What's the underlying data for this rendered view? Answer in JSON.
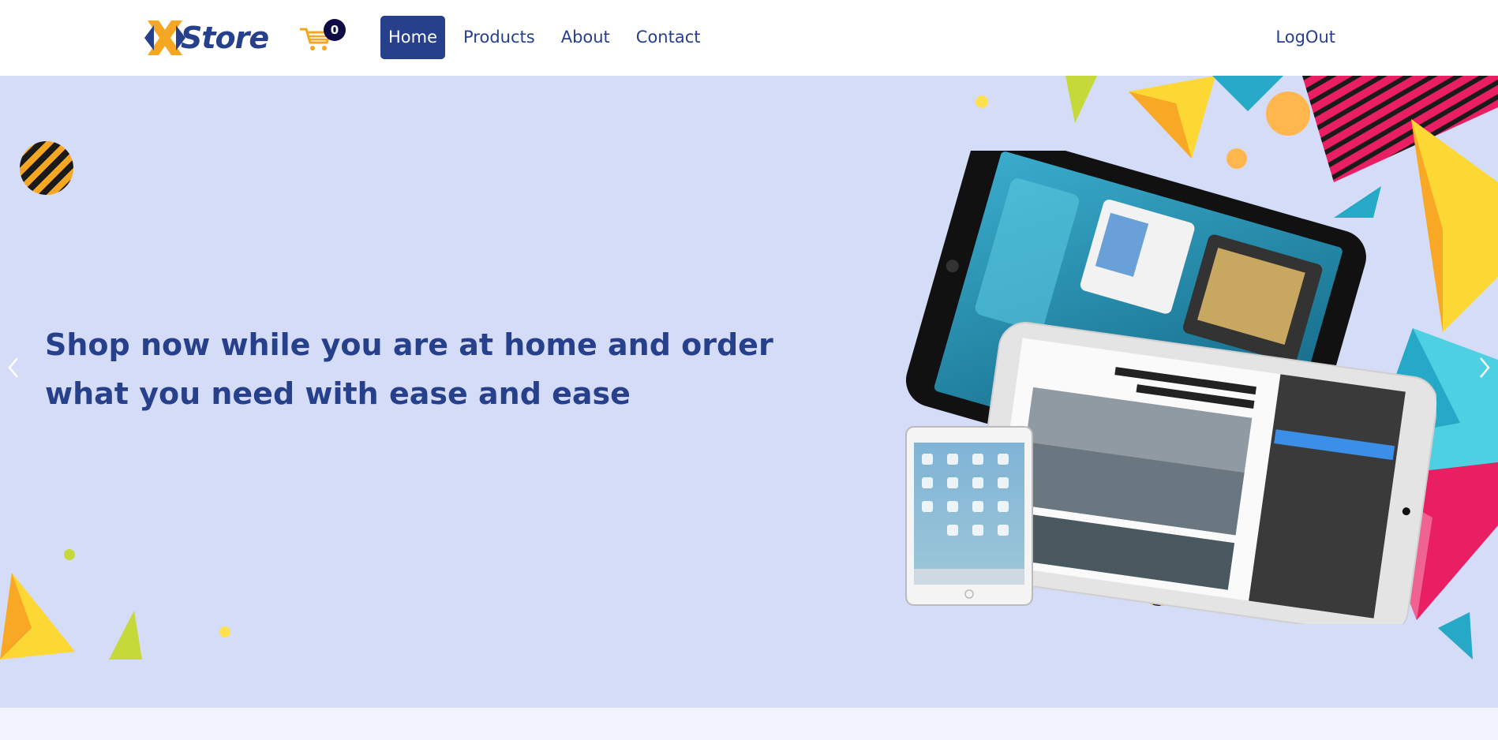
{
  "brand": {
    "name": "Store",
    "logo_letter": "X"
  },
  "cart": {
    "count": "0",
    "icon": "cart-icon"
  },
  "nav": {
    "items": [
      {
        "label": "Home",
        "active": true
      },
      {
        "label": "Products",
        "active": false
      },
      {
        "label": "About",
        "active": false
      },
      {
        "label": "Contact",
        "active": false
      }
    ],
    "logout_label": "LogOut"
  },
  "hero": {
    "headline": "Shop now while you are at home and order what you need with ease and ease",
    "prev_icon": "chevron-left-icon",
    "next_icon": "chevron-right-icon"
  },
  "colors": {
    "brand_blue": "#27408b",
    "hero_bg": "#d4dcf7",
    "accent_yellow": "#f5a623",
    "badge_bg": "#0e0c44"
  }
}
